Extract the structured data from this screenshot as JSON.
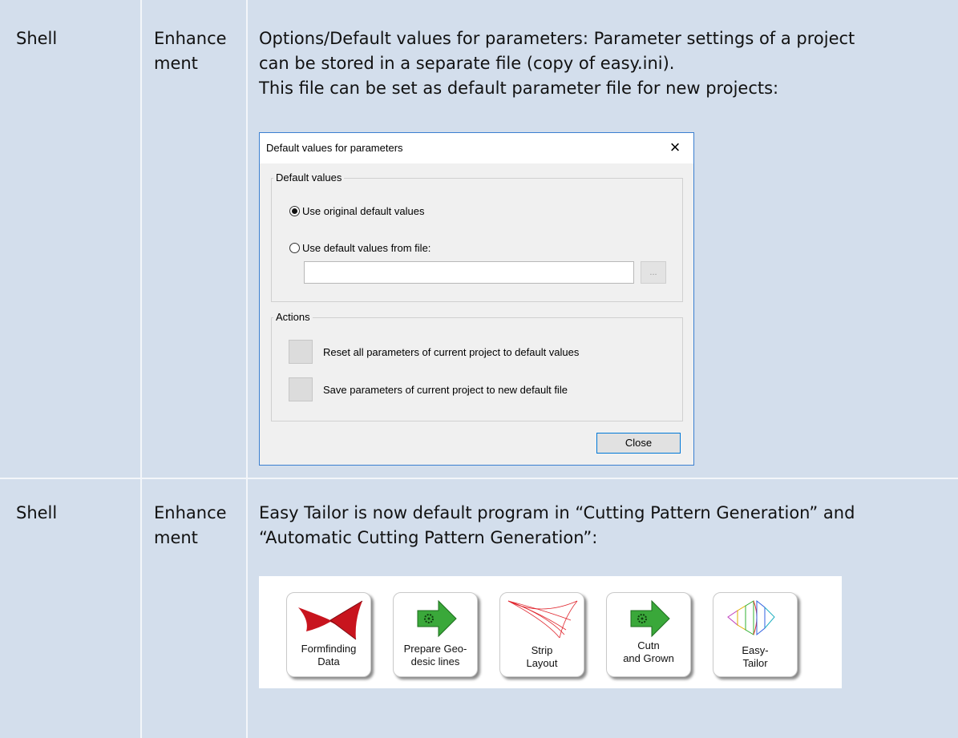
{
  "rows": [
    {
      "component": "Shell",
      "type_line1": "Enhance",
      "type_line2": "ment",
      "desc_line1": "Options/Default values for parameters: Parameter settings of a project",
      "desc_line2": "can be stored in a separate file (copy of easy.ini).",
      "desc_line3": "This file can be set as default parameter file for new projects:"
    },
    {
      "component": "Shell",
      "type_line1": "Enhance",
      "type_line2": "ment",
      "desc_line1": "Easy Tailor is now default program in “Cutting Pattern Generation” and",
      "desc_line2": "“Automatic Cutting Pattern Generation”:"
    }
  ],
  "dialog": {
    "title": "Default values for parameters",
    "close_glyph": "×",
    "default_group": "Default values",
    "radio_original": "Use original default values",
    "radio_original_selected": true,
    "radio_file": "Use default values from file:",
    "radio_file_selected": false,
    "file_path_value": "",
    "browse_label": "...",
    "actions_group": "Actions",
    "action_reset": "Reset all parameters of current project to default values",
    "action_save": "Save parameters of current project to new default file",
    "close_button": "Close"
  },
  "toolbar": [
    {
      "line1": "Formfinding",
      "line2": "Data",
      "icon": "formfinding-icon"
    },
    {
      "line1": "Prepare Geo-",
      "line2": "desic lines",
      "icon": "green-arrow-gear-icon"
    },
    {
      "line1": "Strip",
      "line2": "Layout",
      "icon": "strip-layout-icon"
    },
    {
      "line1": "Cutn",
      "line2": "and Grown",
      "icon": "green-arrow-gear-icon"
    },
    {
      "line1": "Easy-",
      "line2": "Tailor",
      "icon": "easy-tailor-icon"
    }
  ],
  "colors": {
    "cell_bg": "#d3deec",
    "grid": "#f3f6fa",
    "dialog_border": "#3b7fd0",
    "arrow_green": "#3aa83a",
    "red_sail": "#c8141e"
  }
}
